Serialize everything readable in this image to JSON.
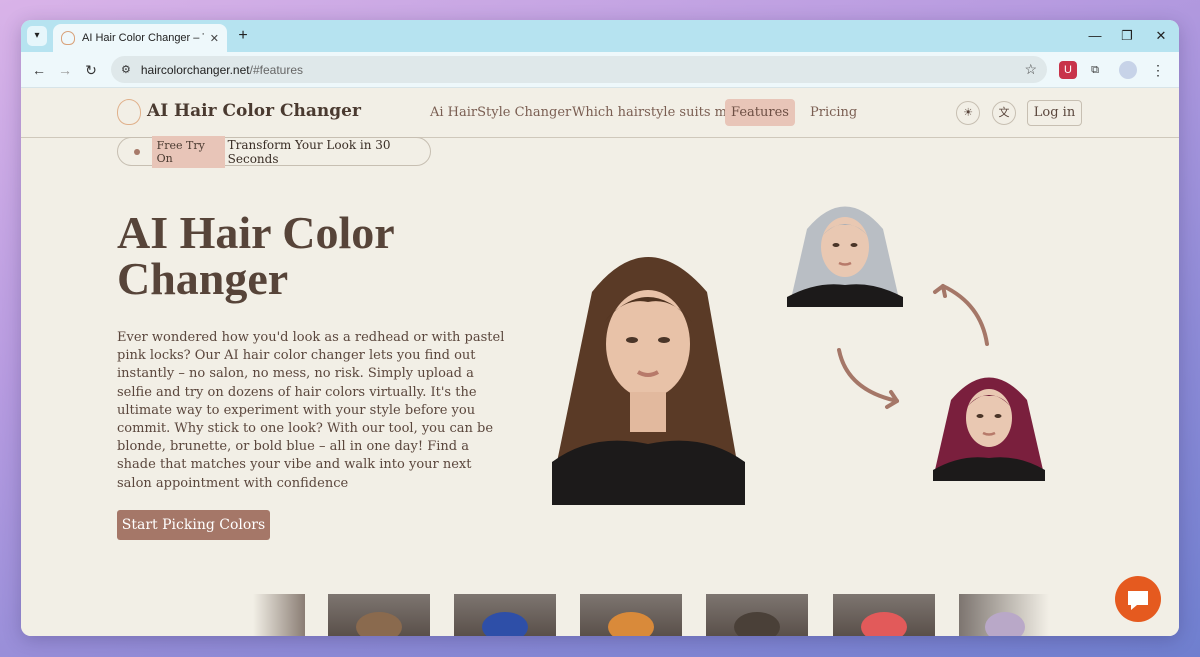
{
  "browser": {
    "tab_title": "AI Hair Color Changer – Try On",
    "url_host": "haircolorchanger.net",
    "url_path": "/#features",
    "new_tab": "+",
    "close_tab": "✕",
    "minimize": "—",
    "restore": "❐",
    "close_window": "✕"
  },
  "header": {
    "logo_text": "AI Hair Color Changer",
    "nav": [
      {
        "label": "Ai HairStyle Changer"
      },
      {
        "label": "Which hairstyle suits me?"
      },
      {
        "label": "Features"
      },
      {
        "label": "Pricing"
      }
    ],
    "login_label": "Log in",
    "theme_icon": "sun-icon",
    "language_icon": "translate-icon"
  },
  "hero": {
    "badge_tag": "Free Try On",
    "badge_text": "Transform Your Look in 30 Seconds",
    "title": "AI Hair Color Changer",
    "description": "Ever wondered how you'd look as a redhead or with pastel pink locks? Our AI hair color changer lets you find out instantly – no salon, no mess, no risk. Simply upload a selfie and try on dozens of hair colors virtually. It's the ultimate way to experiment with your style before you commit. Why stick to one look? With our tool, you can be blonde, brunette, or bold blue – all in one day! Find a shade that matches your vibe and walk into your next salon appointment with confidence",
    "cta_label": "Start Picking Colors"
  },
  "colors": {
    "accent": "#a57768",
    "nav_active_bg": "#e8c5b8",
    "page_bg": "#f2efe6",
    "chat_button": "#e55a1f"
  }
}
